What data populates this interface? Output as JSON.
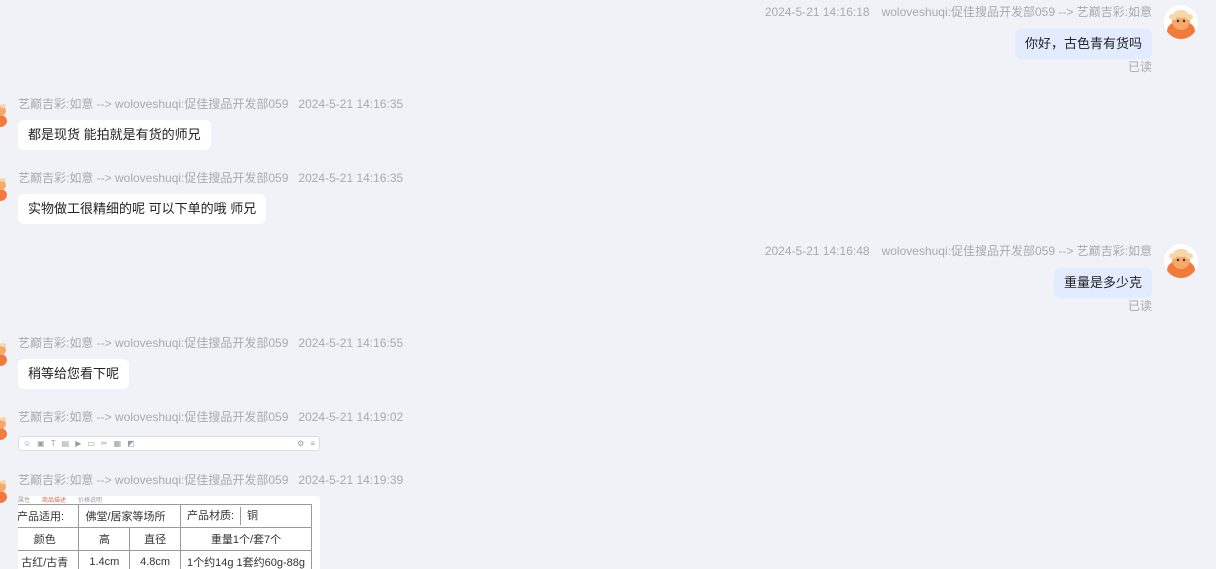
{
  "messages": [
    {
      "side": "right",
      "timestamp": "2024-5-21 14:16:18",
      "route": "woloveshuqi:促佳搜品开发部059 --> 艺巅吉彩:如意",
      "text": "你好，古色青有货吗",
      "status": "已读"
    },
    {
      "side": "left",
      "route": "艺巅吉彩:如意 --> woloveshuqi:促佳搜品开发部059",
      "timestamp": "2024-5-21 14:16:35",
      "text": "都是现货 能拍就是有货的师兄"
    },
    {
      "side": "left",
      "route": "艺巅吉彩:如意 --> woloveshuqi:促佳搜品开发部059",
      "timestamp": "2024-5-21 14:16:35",
      "text": "实物做工很精细的呢 可以下单的哦 师兄"
    },
    {
      "side": "right",
      "timestamp": "2024-5-21 14:16:48",
      "route": "woloveshuqi:促佳搜品开发部059 --> 艺巅吉彩:如意",
      "text": "重量是多少克",
      "status": "已读"
    },
    {
      "side": "left",
      "route": "艺巅吉彩:如意 --> woloveshuqi:促佳搜品开发部059",
      "timestamp": "2024-5-21 14:16:55",
      "text": "稍等给您看下呢"
    },
    {
      "side": "left",
      "route": "艺巅吉彩:如意 --> woloveshuqi:促佳搜品开发部059",
      "timestamp": "2024-5-21 14:19:02",
      "attachment": "toolbar-screenshot"
    },
    {
      "side": "left",
      "route": "艺巅吉彩:如意 --> woloveshuqi:促佳搜品开发部059",
      "timestamp": "2024-5-21 14:19:39",
      "attachment": "spec-table-screenshot"
    }
  ],
  "spec_image": {
    "tabs": [
      "属性",
      "商品描述",
      "价格说明"
    ],
    "rows": [
      [
        "产品适用:",
        "佛堂/居家等场所",
        "产品材质:",
        "铜"
      ],
      [
        "颜色",
        "高",
        "直径",
        "重量1个/套7个"
      ],
      [
        "古红/古青",
        "1.4cm",
        "4.8cm",
        "1个约14g 1套约60g-88g"
      ]
    ]
  },
  "colors": {
    "background": "#f1f2f7",
    "left_bubble": "#ffffff",
    "right_bubble": "#e3ebff",
    "meta_text": "#a8aab0",
    "avatar_orange": "#f27a3a"
  }
}
